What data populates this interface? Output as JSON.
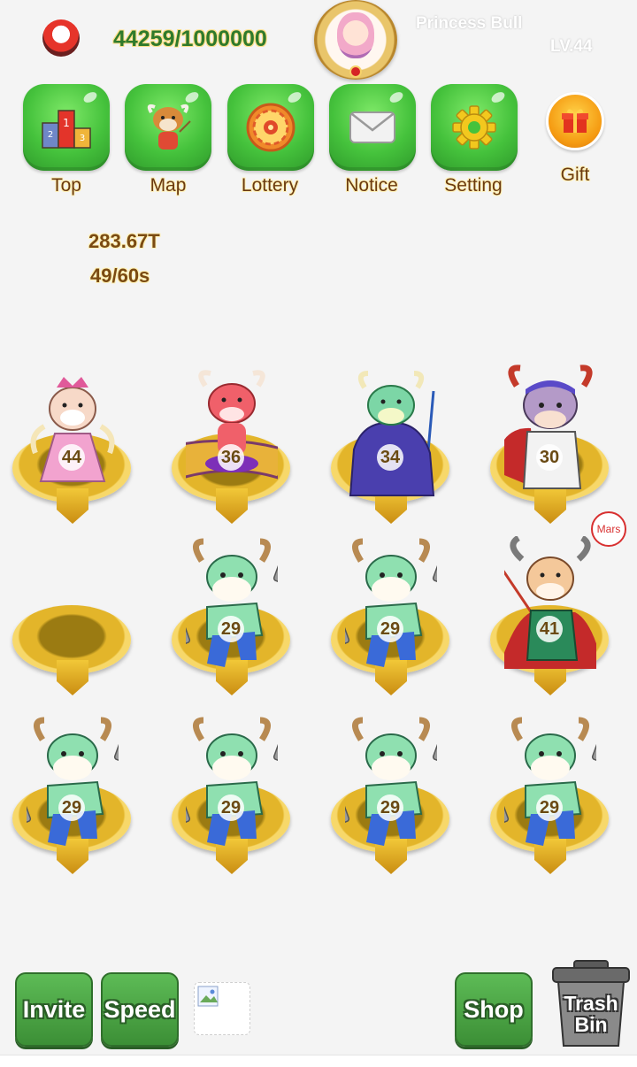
{
  "header": {
    "experience": "44259/1000000",
    "player_name": "Princess Bull",
    "player_level": "LV.44"
  },
  "menu": [
    {
      "label": "Top",
      "icon": "ranking-podium-icon"
    },
    {
      "label": "Map",
      "icon": "bull-teacher-icon"
    },
    {
      "label": "Lottery",
      "icon": "lottery-wheel-icon"
    },
    {
      "label": "Notice",
      "icon": "mail-envelope-icon"
    },
    {
      "label": "Setting",
      "icon": "gear-icon"
    }
  ],
  "gift": {
    "label": "Gift",
    "icon": "gift-box-icon"
  },
  "stats": {
    "income": "283.67T",
    "timer": "49/60s"
  },
  "slots": [
    {
      "level": "44",
      "character": "princess-bull"
    },
    {
      "level": "36",
      "character": "red-bull-flying-carpet"
    },
    {
      "level": "34",
      "character": "green-bull-wizard"
    },
    {
      "level": "30",
      "character": "purple-bull-swordsman"
    },
    {
      "level": null,
      "character": "empty"
    },
    {
      "level": "29",
      "character": "green-bull-nunchaku"
    },
    {
      "level": "29",
      "character": "green-bull-nunchaku"
    },
    {
      "level": "41",
      "character": "mars-bull-spear",
      "tag": "Mars"
    },
    {
      "level": "29",
      "character": "green-bull-nunchaku"
    },
    {
      "level": "29",
      "character": "green-bull-nunchaku"
    },
    {
      "level": "29",
      "character": "green-bull-nunchaku"
    },
    {
      "level": "29",
      "character": "green-bull-nunchaku"
    }
  ],
  "bottom": {
    "invite": "Invite",
    "speed": "Speed",
    "shop": "Shop",
    "trash_line1": "Trash",
    "trash_line2": "Bin"
  },
  "colors": {
    "button_green": "#45c23c",
    "label_brown": "#6b3a10",
    "pad_gold": "#e3b52a"
  }
}
